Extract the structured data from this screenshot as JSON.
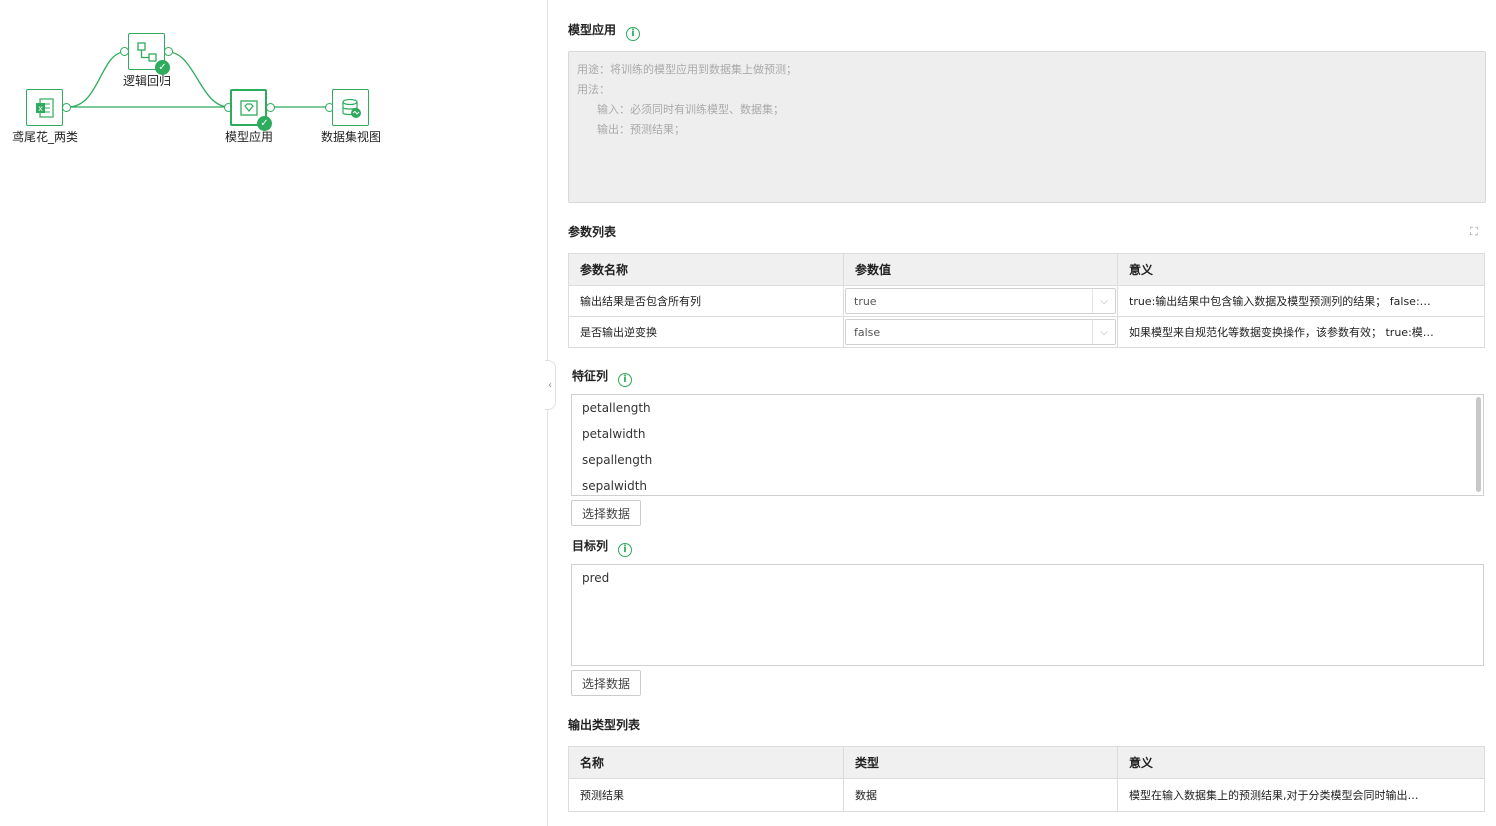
{
  "flow": {
    "nodes": {
      "iris": "鸢尾花_两类",
      "lr": "逻辑回归",
      "apply": "模型应用",
      "view": "数据集视图"
    }
  },
  "panel": {
    "title": "模型应用",
    "description": {
      "purpose": "用途：将训练的模型应用到数据集上做预测；",
      "usage": "用法：",
      "input": "输入：必须同时有训练模型、数据集；",
      "output": "输出：预测结果；"
    },
    "params": {
      "title": "参数列表",
      "headers": [
        "参数名称",
        "参数值",
        "意义"
      ],
      "rows": [
        {
          "name": "输出结果是否包含所有列",
          "value": "true",
          "meaning": "true:输出结果中包含输入数据及模型预测列的结果； false:…"
        },
        {
          "name": "是否输出逆变换",
          "value": "false",
          "meaning": "如果模型来自规范化等数据变换操作，该参数有效； true:模…"
        }
      ]
    },
    "features": {
      "title": "特征列",
      "items": [
        "petallength",
        "petalwidth",
        "sepallength",
        "sepalwidth"
      ],
      "button": "选择数据"
    },
    "target": {
      "title": "目标列",
      "items": [
        "pred"
      ],
      "button": "选择数据"
    },
    "output_types": {
      "title": "输出类型列表",
      "headers": [
        "名称",
        "类型",
        "意义"
      ],
      "rows": [
        {
          "name": "预测结果",
          "type": "数据",
          "meaning": "模型在输入数据集上的预测结果,对于分类模型会同时输出…"
        }
      ]
    }
  }
}
